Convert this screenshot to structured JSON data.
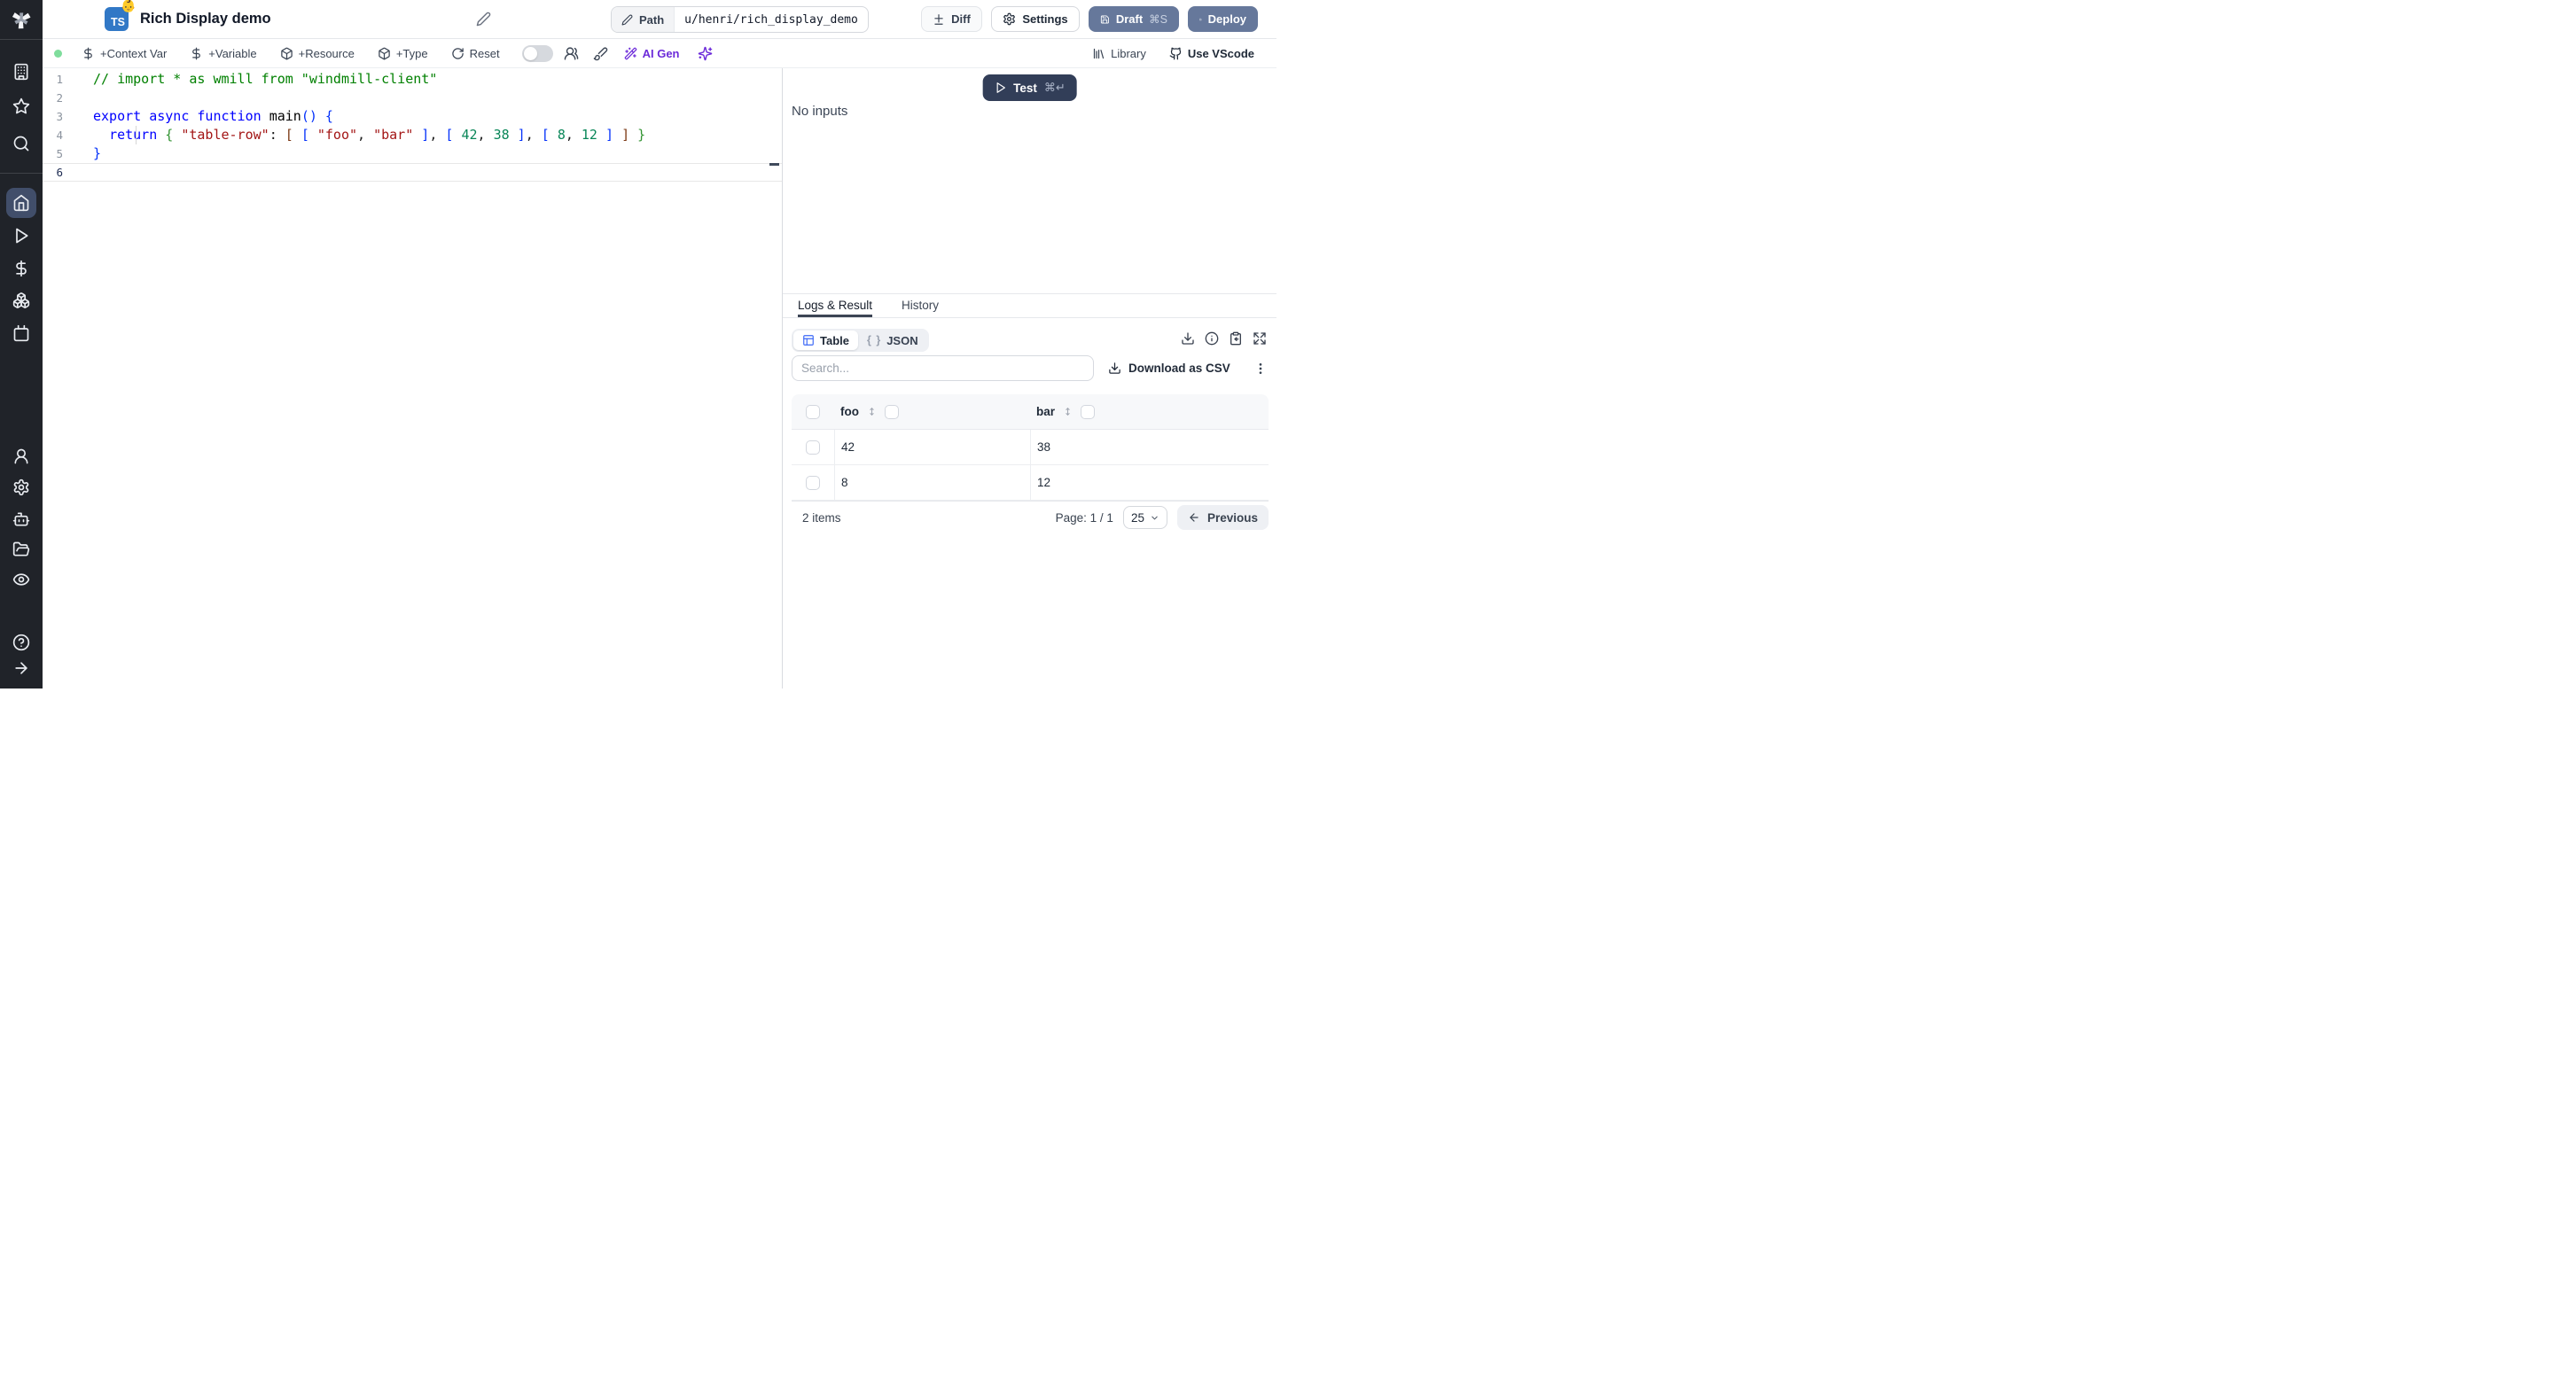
{
  "header": {
    "badge": "TS",
    "badge_emoji": "👶",
    "title": "Rich Display demo",
    "path_label": "Path",
    "path_value": "u/henri/rich_display_demo",
    "diff_label": "Diff",
    "settings_label": "Settings",
    "draft_label": "Draft",
    "draft_shortcut": "⌘S",
    "deploy_label": "Deploy"
  },
  "toolbar": {
    "context_var": "+Context Var",
    "variable": "+Variable",
    "resource": "+Resource",
    "type": "+Type",
    "reset": "Reset",
    "ai_gen": "AI Gen",
    "library": "Library",
    "use_vscode": "Use VScode",
    "icons": [
      "dollar-icon",
      "dollar-icon",
      "package-icon",
      "package-icon",
      "refresh-icon",
      "toggle",
      "collaborators-icon",
      "paintbrush-icon",
      "wand-sparkles-icon",
      "sparkles-icon",
      "library-icon",
      "github-icon"
    ]
  },
  "sidebar": {
    "icons": [
      "windmill-logo",
      "building-icon",
      "star-icon",
      "search-icon",
      "home-icon",
      "play-icon",
      "dollar-icon",
      "boxes-icon",
      "calendar-icon",
      "user-icon",
      "gear-icon",
      "robot-icon",
      "folder-icon",
      "eye-icon",
      "help-icon",
      "arrow-right-icon"
    ],
    "active_item": "home"
  },
  "editor": {
    "active_line": 6,
    "token_colors": {
      "comment": "#008000",
      "kw": "#0000ff",
      "str": "#a31515",
      "num": "#098658",
      "pl": "#1b1b1b",
      "fn": "#000000",
      "b1": "#0431fa",
      "b2": "#319331",
      "b3": "#7b3814"
    },
    "lines": [
      [
        {
          "t": "// import * as wmill from \"windmill-client\"",
          "c": "comment"
        }
      ],
      [],
      [
        {
          "t": "export",
          "c": "kw"
        },
        {
          "t": " ",
          "c": "pl"
        },
        {
          "t": "async",
          "c": "kw"
        },
        {
          "t": " ",
          "c": "pl"
        },
        {
          "t": "function",
          "c": "kw"
        },
        {
          "t": " ",
          "c": "pl"
        },
        {
          "t": "main",
          "c": "fn"
        },
        {
          "t": "(",
          "c": "b1"
        },
        {
          "t": ")",
          "c": "b1"
        },
        {
          "t": " ",
          "c": "pl"
        },
        {
          "t": "{",
          "c": "b1"
        }
      ],
      [
        {
          "t": "  ",
          "c": "pl"
        },
        {
          "t": "return",
          "c": "kw"
        },
        {
          "t": " ",
          "c": "pl"
        },
        {
          "t": "{",
          "c": "b2"
        },
        {
          "t": " ",
          "c": "pl"
        },
        {
          "t": "\"table-row\"",
          "c": "str"
        },
        {
          "t": ": ",
          "c": "pl"
        },
        {
          "t": "[",
          "c": "b3"
        },
        {
          "t": " ",
          "c": "pl"
        },
        {
          "t": "[",
          "c": "b1"
        },
        {
          "t": " ",
          "c": "pl"
        },
        {
          "t": "\"foo\"",
          "c": "str"
        },
        {
          "t": ", ",
          "c": "pl"
        },
        {
          "t": "\"bar\"",
          "c": "str"
        },
        {
          "t": " ",
          "c": "pl"
        },
        {
          "t": "]",
          "c": "b1"
        },
        {
          "t": ", ",
          "c": "pl"
        },
        {
          "t": "[",
          "c": "b1"
        },
        {
          "t": " ",
          "c": "pl"
        },
        {
          "t": "42",
          "c": "num"
        },
        {
          "t": ", ",
          "c": "pl"
        },
        {
          "t": "38",
          "c": "num"
        },
        {
          "t": " ",
          "c": "pl"
        },
        {
          "t": "]",
          "c": "b1"
        },
        {
          "t": ", ",
          "c": "pl"
        },
        {
          "t": "[",
          "c": "b1"
        },
        {
          "t": " ",
          "c": "pl"
        },
        {
          "t": "8",
          "c": "num"
        },
        {
          "t": ", ",
          "c": "pl"
        },
        {
          "t": "12",
          "c": "num"
        },
        {
          "t": " ",
          "c": "pl"
        },
        {
          "t": "]",
          "c": "b1"
        },
        {
          "t": " ",
          "c": "pl"
        },
        {
          "t": "]",
          "c": "b3"
        },
        {
          "t": " ",
          "c": "pl"
        },
        {
          "t": "}",
          "c": "b2"
        }
      ],
      [
        {
          "t": "}",
          "c": "b1"
        }
      ],
      []
    ]
  },
  "run_panel": {
    "test_label": "Test",
    "test_shortcut": "⌘↵",
    "no_inputs": "No inputs"
  },
  "results": {
    "tabs": [
      "Logs & Result",
      "History"
    ],
    "active_tab": 0,
    "view_table": "Table",
    "view_json": "JSON",
    "json_braces": "{ }",
    "action_icons": [
      "download-icon",
      "info-icon",
      "clipboard-copy-icon",
      "expand-icon"
    ],
    "search_placeholder": "Search...",
    "download_csv": "Download as CSV",
    "table": {
      "columns": [
        "foo",
        "bar"
      ],
      "rows": [
        [
          "42",
          "38"
        ],
        [
          "8",
          "12"
        ]
      ]
    },
    "footer": {
      "count": "2 items",
      "page": "Page: 1 / 1",
      "page_size": "25",
      "previous": "Previous"
    }
  },
  "colors": {
    "sidebar_bg": "#202329",
    "active_item_bg": "#414e6a",
    "brand_blue": "#66789b",
    "test_button": "#323e58",
    "ai_purple": "#6c2bd9",
    "ts_badge": "#3178c6",
    "status_green": "#7fdd9c",
    "table_icon": "#3b68f6",
    "tab_underline": "#3c4454"
  }
}
